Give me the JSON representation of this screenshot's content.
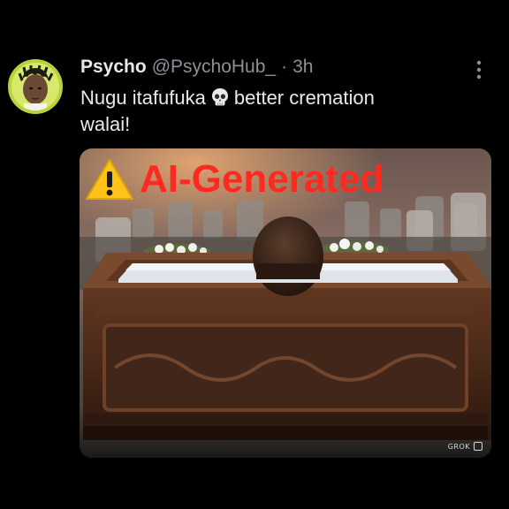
{
  "post": {
    "author_name": "Psycho",
    "author_handle": "@PsychoHub_",
    "separator": "·",
    "time": "3h",
    "text_line1_before": "Nugu itafufuka",
    "text_line1_after": "better cremation",
    "text_line2": "walai!",
    "emoji_icon": "skull-icon",
    "more_icon": "vertical-ellipsis-icon"
  },
  "media": {
    "overlay_label": "AI-Generated",
    "overlay_color": "#ff2a1f",
    "warning_icon": "warning-triangle-icon",
    "watermark_text": "GROK"
  },
  "colors": {
    "background": "#000000",
    "text": "#e7e9ea",
    "secondary_text": "#8b9196",
    "avatar_ring": "#b9d23c"
  }
}
